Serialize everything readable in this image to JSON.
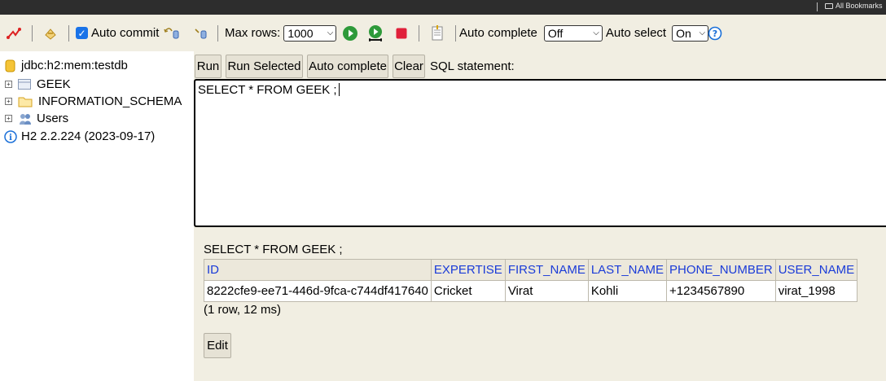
{
  "browser": {
    "bookmarks_label": "All Bookmarks"
  },
  "toolbar": {
    "auto_commit_label": "Auto commit",
    "max_rows_label": "Max rows:",
    "max_rows_value": "1000",
    "auto_complete_label": "Auto complete",
    "auto_complete_value": "Off",
    "auto_select_label": "Auto select",
    "auto_select_value": "On"
  },
  "tree": {
    "connection": "jdbc:h2:mem:testdb",
    "items": [
      {
        "label": "GEEK"
      },
      {
        "label": "INFORMATION_SCHEMA"
      },
      {
        "label": "Users"
      }
    ],
    "version": "H2 2.2.224 (2023-09-17)"
  },
  "editor": {
    "buttons": {
      "run": "Run",
      "run_selected": "Run Selected",
      "auto_complete": "Auto complete",
      "clear": "Clear"
    },
    "label": "SQL statement:",
    "text": "SELECT * FROM GEEK ;"
  },
  "result": {
    "sql": "SELECT * FROM GEEK ;",
    "columns": [
      "ID",
      "EXPERTISE",
      "FIRST_NAME",
      "LAST_NAME",
      "PHONE_NUMBER",
      "USER_NAME"
    ],
    "rows": [
      [
        "8222cfe9-ee71-446d-9fca-c744df417640",
        "Cricket",
        "Virat",
        "Kohli",
        "+1234567890",
        "virat_1998"
      ]
    ],
    "summary": "(1 row, 12 ms)",
    "edit_label": "Edit"
  },
  "colors": {
    "panel_bg": "#f1eee2",
    "header_link": "#1a3bd8",
    "checkbox": "#1a73e8"
  }
}
